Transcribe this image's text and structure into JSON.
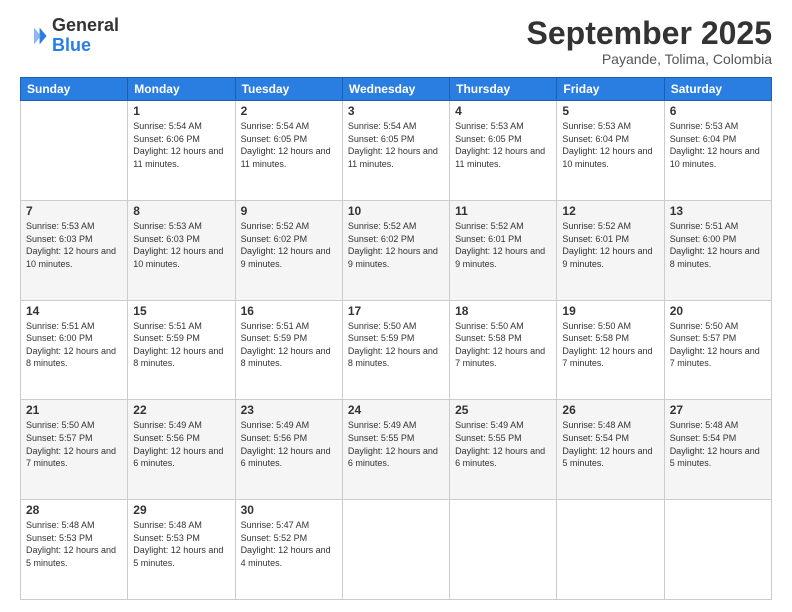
{
  "logo": {
    "general": "General",
    "blue": "Blue"
  },
  "header": {
    "month": "September 2025",
    "location": "Payande, Tolima, Colombia"
  },
  "weekdays": [
    "Sunday",
    "Monday",
    "Tuesday",
    "Wednesday",
    "Thursday",
    "Friday",
    "Saturday"
  ],
  "weeks": [
    [
      {
        "day": "",
        "sunrise": "",
        "sunset": "",
        "daylight": ""
      },
      {
        "day": "1",
        "sunrise": "Sunrise: 5:54 AM",
        "sunset": "Sunset: 6:06 PM",
        "daylight": "Daylight: 12 hours and 11 minutes."
      },
      {
        "day": "2",
        "sunrise": "Sunrise: 5:54 AM",
        "sunset": "Sunset: 6:05 PM",
        "daylight": "Daylight: 12 hours and 11 minutes."
      },
      {
        "day": "3",
        "sunrise": "Sunrise: 5:54 AM",
        "sunset": "Sunset: 6:05 PM",
        "daylight": "Daylight: 12 hours and 11 minutes."
      },
      {
        "day": "4",
        "sunrise": "Sunrise: 5:53 AM",
        "sunset": "Sunset: 6:05 PM",
        "daylight": "Daylight: 12 hours and 11 minutes."
      },
      {
        "day": "5",
        "sunrise": "Sunrise: 5:53 AM",
        "sunset": "Sunset: 6:04 PM",
        "daylight": "Daylight: 12 hours and 10 minutes."
      },
      {
        "day": "6",
        "sunrise": "Sunrise: 5:53 AM",
        "sunset": "Sunset: 6:04 PM",
        "daylight": "Daylight: 12 hours and 10 minutes."
      }
    ],
    [
      {
        "day": "7",
        "sunrise": "Sunrise: 5:53 AM",
        "sunset": "Sunset: 6:03 PM",
        "daylight": "Daylight: 12 hours and 10 minutes."
      },
      {
        "day": "8",
        "sunrise": "Sunrise: 5:53 AM",
        "sunset": "Sunset: 6:03 PM",
        "daylight": "Daylight: 12 hours and 10 minutes."
      },
      {
        "day": "9",
        "sunrise": "Sunrise: 5:52 AM",
        "sunset": "Sunset: 6:02 PM",
        "daylight": "Daylight: 12 hours and 9 minutes."
      },
      {
        "day": "10",
        "sunrise": "Sunrise: 5:52 AM",
        "sunset": "Sunset: 6:02 PM",
        "daylight": "Daylight: 12 hours and 9 minutes."
      },
      {
        "day": "11",
        "sunrise": "Sunrise: 5:52 AM",
        "sunset": "Sunset: 6:01 PM",
        "daylight": "Daylight: 12 hours and 9 minutes."
      },
      {
        "day": "12",
        "sunrise": "Sunrise: 5:52 AM",
        "sunset": "Sunset: 6:01 PM",
        "daylight": "Daylight: 12 hours and 9 minutes."
      },
      {
        "day": "13",
        "sunrise": "Sunrise: 5:51 AM",
        "sunset": "Sunset: 6:00 PM",
        "daylight": "Daylight: 12 hours and 8 minutes."
      }
    ],
    [
      {
        "day": "14",
        "sunrise": "Sunrise: 5:51 AM",
        "sunset": "Sunset: 6:00 PM",
        "daylight": "Daylight: 12 hours and 8 minutes."
      },
      {
        "day": "15",
        "sunrise": "Sunrise: 5:51 AM",
        "sunset": "Sunset: 5:59 PM",
        "daylight": "Daylight: 12 hours and 8 minutes."
      },
      {
        "day": "16",
        "sunrise": "Sunrise: 5:51 AM",
        "sunset": "Sunset: 5:59 PM",
        "daylight": "Daylight: 12 hours and 8 minutes."
      },
      {
        "day": "17",
        "sunrise": "Sunrise: 5:50 AM",
        "sunset": "Sunset: 5:59 PM",
        "daylight": "Daylight: 12 hours and 8 minutes."
      },
      {
        "day": "18",
        "sunrise": "Sunrise: 5:50 AM",
        "sunset": "Sunset: 5:58 PM",
        "daylight": "Daylight: 12 hours and 7 minutes."
      },
      {
        "day": "19",
        "sunrise": "Sunrise: 5:50 AM",
        "sunset": "Sunset: 5:58 PM",
        "daylight": "Daylight: 12 hours and 7 minutes."
      },
      {
        "day": "20",
        "sunrise": "Sunrise: 5:50 AM",
        "sunset": "Sunset: 5:57 PM",
        "daylight": "Daylight: 12 hours and 7 minutes."
      }
    ],
    [
      {
        "day": "21",
        "sunrise": "Sunrise: 5:50 AM",
        "sunset": "Sunset: 5:57 PM",
        "daylight": "Daylight: 12 hours and 7 minutes."
      },
      {
        "day": "22",
        "sunrise": "Sunrise: 5:49 AM",
        "sunset": "Sunset: 5:56 PM",
        "daylight": "Daylight: 12 hours and 6 minutes."
      },
      {
        "day": "23",
        "sunrise": "Sunrise: 5:49 AM",
        "sunset": "Sunset: 5:56 PM",
        "daylight": "Daylight: 12 hours and 6 minutes."
      },
      {
        "day": "24",
        "sunrise": "Sunrise: 5:49 AM",
        "sunset": "Sunset: 5:55 PM",
        "daylight": "Daylight: 12 hours and 6 minutes."
      },
      {
        "day": "25",
        "sunrise": "Sunrise: 5:49 AM",
        "sunset": "Sunset: 5:55 PM",
        "daylight": "Daylight: 12 hours and 6 minutes."
      },
      {
        "day": "26",
        "sunrise": "Sunrise: 5:48 AM",
        "sunset": "Sunset: 5:54 PM",
        "daylight": "Daylight: 12 hours and 5 minutes."
      },
      {
        "day": "27",
        "sunrise": "Sunrise: 5:48 AM",
        "sunset": "Sunset: 5:54 PM",
        "daylight": "Daylight: 12 hours and 5 minutes."
      }
    ],
    [
      {
        "day": "28",
        "sunrise": "Sunrise: 5:48 AM",
        "sunset": "Sunset: 5:53 PM",
        "daylight": "Daylight: 12 hours and 5 minutes."
      },
      {
        "day": "29",
        "sunrise": "Sunrise: 5:48 AM",
        "sunset": "Sunset: 5:53 PM",
        "daylight": "Daylight: 12 hours and 5 minutes."
      },
      {
        "day": "30",
        "sunrise": "Sunrise: 5:47 AM",
        "sunset": "Sunset: 5:52 PM",
        "daylight": "Daylight: 12 hours and 4 minutes."
      },
      {
        "day": "",
        "sunrise": "",
        "sunset": "",
        "daylight": ""
      },
      {
        "day": "",
        "sunrise": "",
        "sunset": "",
        "daylight": ""
      },
      {
        "day": "",
        "sunrise": "",
        "sunset": "",
        "daylight": ""
      },
      {
        "day": "",
        "sunrise": "",
        "sunset": "",
        "daylight": ""
      }
    ]
  ]
}
